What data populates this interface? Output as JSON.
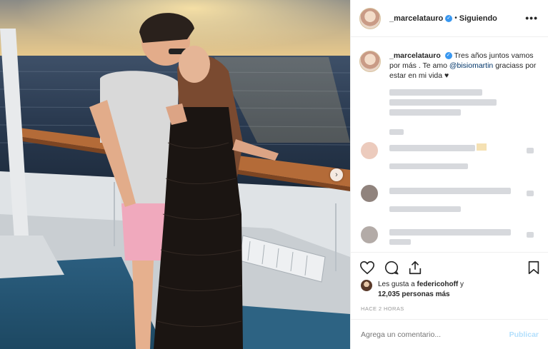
{
  "post": {
    "header": {
      "username": "_marcelatauro",
      "separator": "•",
      "follow_label": "Siguiendo",
      "more_label": "•••"
    },
    "caption": {
      "username": "_marcelatauro",
      "text_1": "Tres años juntos vamos por más . Te amo ",
      "mention": "@bisiomartin",
      "text_2": " graciass por estar en mi vida ",
      "heart": "♥"
    },
    "likes": {
      "prefix": "Les gusta a ",
      "user": "federicohoff",
      "middle": " y",
      "count": "12,035 personas más"
    },
    "timestamp": "HACE 2 HORAS",
    "comment_input": {
      "placeholder": "Agrega un comentario..."
    },
    "publish_label": "Publicar",
    "next_arrow": "›"
  },
  "colors": {
    "verified": "#3897f0",
    "publish": "#b2dffc",
    "mention": "#003569"
  },
  "icons": [
    "verified-badge-icon",
    "more-options-icon",
    "heart-icon",
    "comment-icon",
    "share-icon",
    "bookmark-icon",
    "next-arrow-icon"
  ]
}
